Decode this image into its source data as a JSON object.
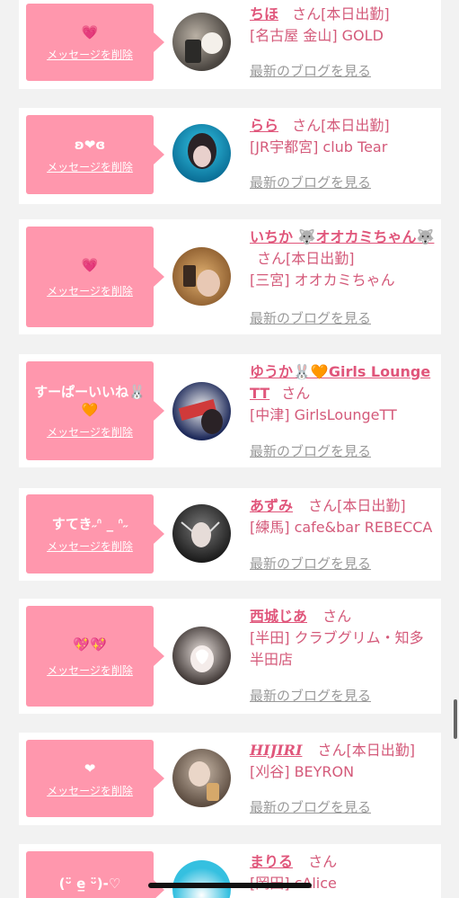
{
  "common": {
    "delete_label": "メッセージを削除",
    "blog_label": "最新のブログを見る",
    "san": "さん"
  },
  "entries": [
    {
      "message": "💗",
      "name": "ちほ",
      "status": "[本日出勤]",
      "store": "[名古屋 金山] GOLD"
    },
    {
      "message": "ʚ❤ɞ",
      "name": "らら",
      "status": "[本日出勤]",
      "store": "[JR宇都宮] club Tear"
    },
    {
      "message": "💗",
      "name": "いちか 🐺オオカミちゃん🐺",
      "status": "[本日出勤]",
      "store": "[三宮] オオカミちゃん"
    },
    {
      "message": "すーぱーいいね🐰🧡",
      "name": "ゆうか🐰🧡Girls Lounge TT",
      "status": "",
      "store": "[中津] GirlsLoungeTT"
    },
    {
      "message": "すてき˶ᐢ _ ᐢ˶",
      "name": "あずみ",
      "status": "[本日出勤]",
      "store": "[練馬] cafe&bar REBECCA"
    },
    {
      "message": "💖💖",
      "name": "西城じあ",
      "status": "",
      "store": "[半田] クラブグリム・知多半田店"
    },
    {
      "message": "❤",
      "name": "HIJIRI",
      "status": "[本日出勤]",
      "store": "[刈谷] BEYRON"
    },
    {
      "message": "(ᵕ̈ e̲ ᵕ̈)-♡",
      "name": "まりる",
      "status": "",
      "store": "[岡田] cAlice"
    }
  ],
  "colors": {
    "bubble": "#ff97ad",
    "name": "#e0567b",
    "store": "#d45a7a",
    "blog": "#9a9a9a",
    "background": "#f2f2f2"
  }
}
